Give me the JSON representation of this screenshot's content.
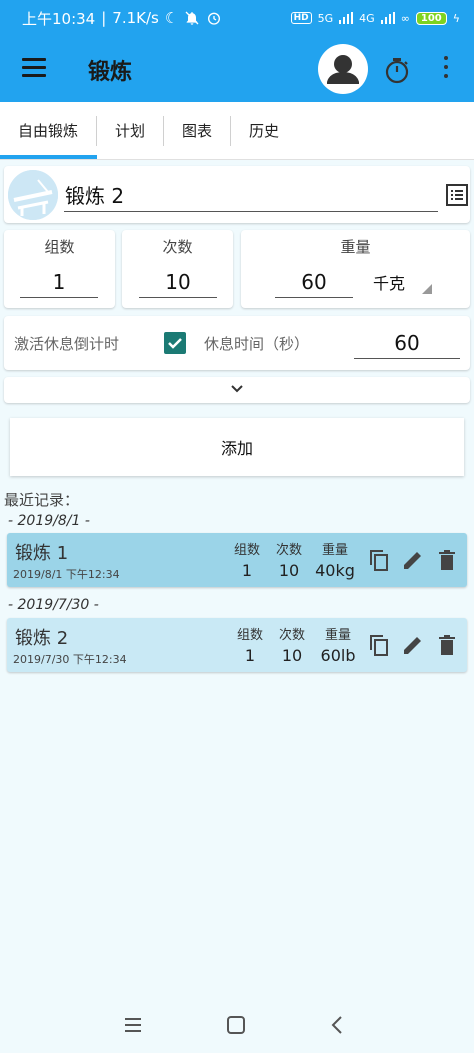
{
  "status_bar": {
    "time": "上午10:34",
    "speed": "7.1K/s",
    "hd": "HD",
    "net1": "5G",
    "net2": "4G",
    "battery": "100"
  },
  "app_bar": {
    "title": "锻炼"
  },
  "tabs": [
    {
      "label": "自由锻炼",
      "active": true
    },
    {
      "label": "计划"
    },
    {
      "label": "图表"
    },
    {
      "label": "历史"
    }
  ],
  "exercise": {
    "name": "锻炼 2"
  },
  "fields": {
    "sets_label": "组数",
    "sets_value": "1",
    "reps_label": "次数",
    "reps_value": "10",
    "weight_label": "重量",
    "weight_value": "60",
    "unit": "千克"
  },
  "rest": {
    "countdown_label": "激活休息倒计时",
    "checked": true,
    "time_label": "休息时间（秒）",
    "time_value": "60"
  },
  "add_button": "添加",
  "recent": {
    "title": "最近记录：",
    "groups": [
      {
        "date": "- 2019/8/1 -",
        "entry": {
          "name": "锻炼 1",
          "time": "2019/8/1  下午12:34",
          "sets_h": "组数",
          "sets": "1",
          "reps_h": "次数",
          "reps": "10",
          "weight_h": "重量",
          "weight": "40kg"
        }
      },
      {
        "date": "- 2019/7/30 -",
        "entry": {
          "name": "锻炼 2",
          "time": "2019/7/30  下午12:34",
          "sets_h": "组数",
          "sets": "1",
          "reps_h": "次数",
          "reps": "10",
          "weight_h": "重量",
          "weight": "60lb"
        }
      }
    ]
  },
  "colors": {
    "primary": "#22a3ef",
    "checkbox": "#1b7a74",
    "row_selected": "#9bd4e8",
    "row_normal": "#c9e9f5"
  }
}
